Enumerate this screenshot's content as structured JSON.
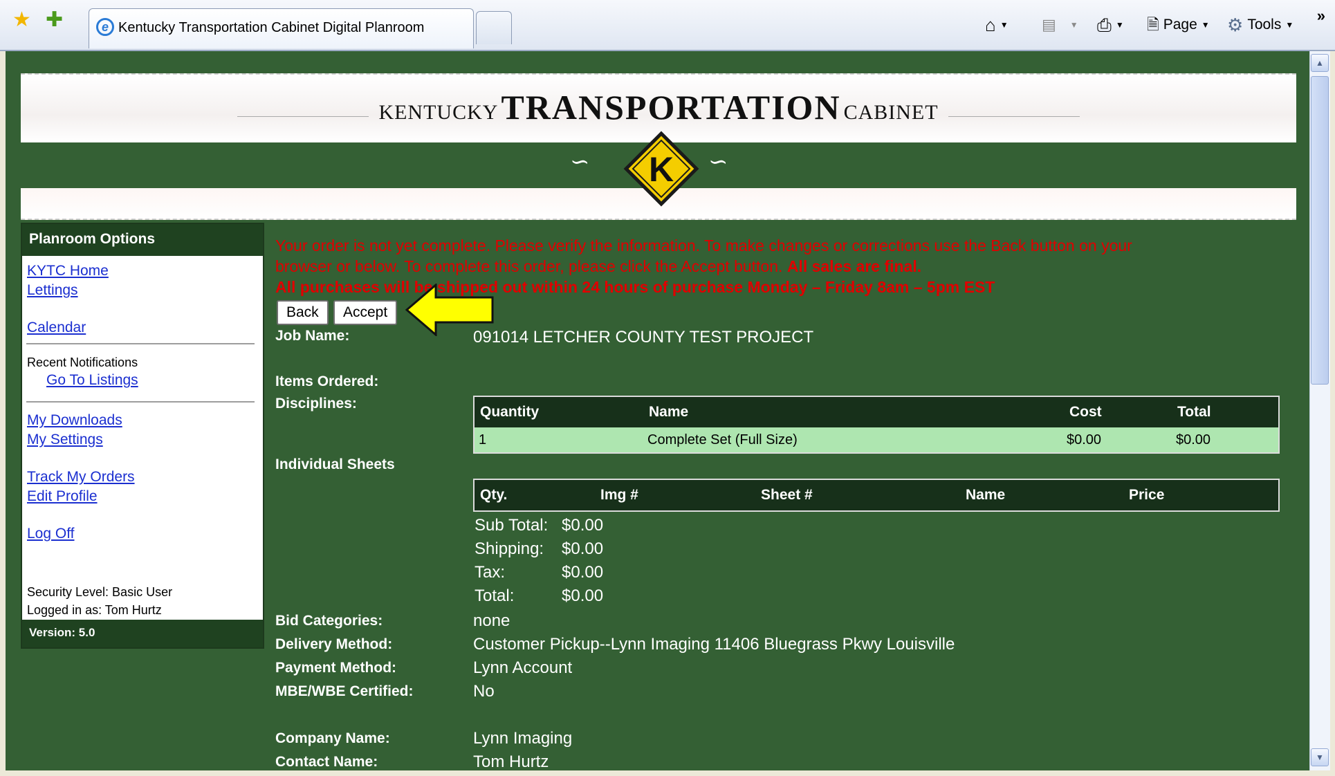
{
  "browser": {
    "tab_title": "Kentucky Transportation Cabinet Digital Planroom",
    "toolbar": {
      "page_label": "Page",
      "tools_label": "Tools",
      "overflow": "»"
    }
  },
  "banner": {
    "left": "KENTUCKY",
    "center": "TRANSPORTATION",
    "right": "CABINET",
    "logo_letter": "K"
  },
  "sidebar": {
    "heading": "Planroom Options",
    "kytc_home": "KYTC Home",
    "lettings": "Lettings",
    "calendar": "Calendar",
    "recent_notifications": "Recent Notifications",
    "go_to_listings": "Go To Listings",
    "my_downloads": "My Downloads",
    "my_settings": "My Settings",
    "track_my_orders": "Track My Orders",
    "edit_profile": "Edit Profile",
    "log_off": "Log Off",
    "security_level": "Security Level: Basic User",
    "logged_in_as": "Logged in as: Tom Hurtz",
    "version": "Version: 5.0"
  },
  "notice": {
    "line1": "Your order is not yet complete. Please verify the information. To make changes or corrections use the Back button on your",
    "line2_a": "browser or below. To complete this order, please click the Accept button.",
    "line2_b": "All sales are final.",
    "line3": "All purchases will be shipped out within 24 hours of purchase Monday – Friday 8am – 5pm EST"
  },
  "buttons": {
    "back": "Back",
    "accept": "Accept"
  },
  "order": {
    "job_name_label": "Job Name:",
    "job_name": "091014 LETCHER COUNTY TEST PROJECT",
    "items_ordered_label": "Items Ordered:",
    "disciplines_label": "Disciplines:",
    "disciplines_headers": [
      "Quantity",
      "Name",
      "Cost",
      "Total"
    ],
    "disciplines_rows": [
      {
        "quantity": "1",
        "name": "Complete Set (Full Size)",
        "cost": "$0.00",
        "total": "$0.00"
      }
    ],
    "individual_sheets_label": "Individual Sheets",
    "sheets_headers": [
      "Qty.",
      "Img #",
      "Sheet #",
      "Name",
      "Price"
    ],
    "summary": {
      "subtotal_label": "Sub Total:",
      "subtotal": "$0.00",
      "shipping_label": "Shipping:",
      "shipping": "$0.00",
      "tax_label": "Tax:",
      "tax": "$0.00",
      "total_label": "Total:",
      "total": "$0.00"
    },
    "bid_categories_label": "Bid Categories:",
    "bid_categories": "none",
    "delivery_method_label": "Delivery Method:",
    "delivery_method": "Customer Pickup--Lynn Imaging 11406 Bluegrass Pkwy Louisville",
    "payment_method_label": "Payment Method:",
    "payment_method": "Lynn Account",
    "mbe_label": "MBE/WBE Certified:",
    "mbe": "No",
    "company_name_label": "Company Name:",
    "company_name": "Lynn Imaging",
    "contact_name_label": "Contact Name:",
    "contact_name": "Tom Hurtz"
  },
  "colors": {
    "page_bg": "#346034",
    "header_green": "#1f4220",
    "notice_red": "#e00000",
    "row_green": "#aee6b0",
    "link_blue": "#1b2fd0",
    "arrow_yellow": "#ffff00"
  },
  "icons": [
    "favorites-star-icon",
    "add-favorites-icon",
    "ie-icon",
    "home-icon",
    "rss-feed-icon",
    "print-icon",
    "page-icon",
    "tools-gear-icon",
    "annotation-arrow-icon"
  ]
}
